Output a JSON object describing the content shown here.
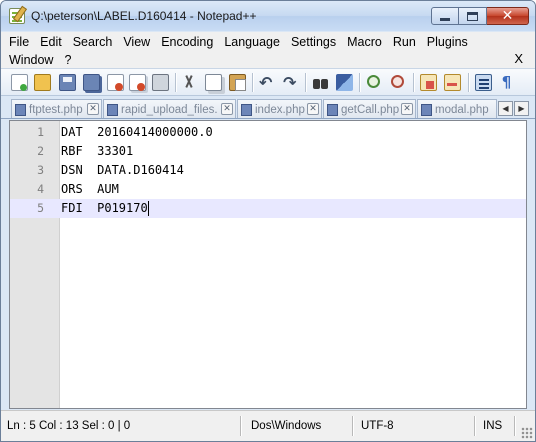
{
  "window": {
    "title": "Q:\\peterson\\LABEL.D160414 - Notepad++"
  },
  "menu": {
    "row1": [
      "File",
      "Edit",
      "Search",
      "View",
      "Encoding",
      "Language",
      "Settings",
      "Macro",
      "Run",
      "Plugins"
    ],
    "row2": [
      "Window",
      "?"
    ],
    "close_x": "X"
  },
  "toolbar": {
    "icons": [
      "new-file",
      "open-file",
      "save",
      "save-all",
      "close",
      "close-all",
      "print",
      "cut",
      "copy",
      "paste",
      "undo",
      "redo",
      "find",
      "replace",
      "zoom-in",
      "zoom-out",
      "sync-vertical",
      "sync-horizontal",
      "word-wrap",
      "show-all-characters"
    ],
    "undo_glyph": "↶",
    "redo_glyph": "↷",
    "pilcrow_glyph": "¶"
  },
  "tabs": [
    {
      "label": "ftptest.php",
      "close": "✕"
    },
    {
      "label": "rapid_upload_files.pl",
      "close": "✕"
    },
    {
      "label": "index.php",
      "close": "✕"
    },
    {
      "label": "getCall.php",
      "close": "✕"
    },
    {
      "label": "modal.php",
      "close": "✕"
    }
  ],
  "tab_scroll": {
    "left": "◀",
    "right": "▶"
  },
  "editor": {
    "lines": [
      {
        "num": "1",
        "text": "DAT  20160414000000.0"
      },
      {
        "num": "2",
        "text": "RBF  33301"
      },
      {
        "num": "3",
        "text": "DSN  DATA.D160414"
      },
      {
        "num": "4",
        "text": "ORS  AUM"
      },
      {
        "num": "5",
        "text": "FDI  P019170"
      }
    ],
    "current_line": 5
  },
  "status": {
    "position": "Ln : 5    Col : 13    Sel : 0 | 0",
    "eol": "Dos\\Windows",
    "encoding": "UTF-8",
    "mode": "INS"
  },
  "colors": {
    "current_line_bg": "#e8e8ff",
    "gutter_bg": "#e4e4e4",
    "line_number_fg": "#808080"
  }
}
